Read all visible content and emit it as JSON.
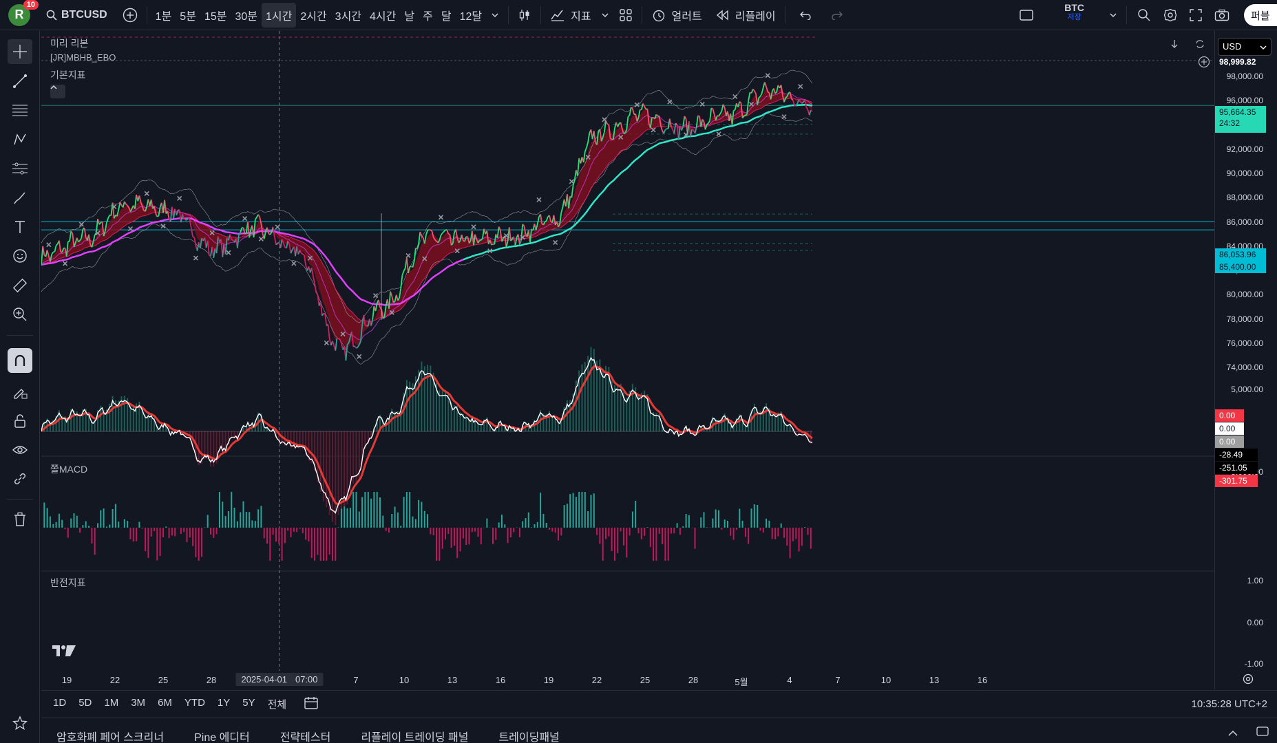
{
  "topbar": {
    "avatar_letter": "R",
    "notif_count": "10",
    "symbol": "BTCUSD",
    "timeframes": [
      "1분",
      "5분",
      "15분",
      "30분",
      "1시간",
      "2시간",
      "3시간",
      "4시간",
      "날",
      "주",
      "달",
      "12달"
    ],
    "active_timeframe": "1시간",
    "indicators_label": "지표",
    "alert_label": "얼러트",
    "replay_label": "리플레이",
    "layout_name": "BTC",
    "layout_sub": "저장",
    "publish_label": "퍼블"
  },
  "panes": {
    "main_labels": [
      "미리 리본",
      "[JR]MBHB_EBO",
      "기본지표"
    ],
    "macd_label": "쫄MACD",
    "reversal_label": "반전지표"
  },
  "price_scale": {
    "currency": "USD",
    "main_ticks": [
      "98,000.00",
      "96,000.00",
      "94,000.00",
      "92,000.00",
      "90,000.00",
      "88,000.00",
      "86,000.00",
      "84,000.00",
      "82,000.00",
      "80,000.00",
      "78,000.00",
      "76,000.00",
      "74,000.00"
    ],
    "top_price": "98,999.82",
    "last_price": "95,664.35",
    "countdown": "24:32",
    "level_1": "86,053.96",
    "level_2": "85,400.00",
    "macd_ticks": [
      "5,000.00",
      "-5,000.00"
    ],
    "macd_values": [
      "0.00",
      "0.00",
      "0.00",
      "-28.49",
      "-251.05",
      "-301.75"
    ],
    "reversal_ticks": [
      "1.00",
      "0.00",
      "-1.00"
    ]
  },
  "time_axis": {
    "labels": [
      "19",
      "22",
      "25",
      "28",
      "4",
      "7",
      "10",
      "13",
      "16",
      "19",
      "22",
      "25",
      "28",
      "5월",
      "4",
      "7",
      "10",
      "13",
      "16"
    ],
    "crosshair_date": "2025-04-01",
    "crosshair_time": "07:00"
  },
  "range_bar": {
    "ranges": [
      "1D",
      "5D",
      "1M",
      "3M",
      "6M",
      "YTD",
      "1Y",
      "5Y",
      "전체"
    ],
    "clock": "10:35:28 UTC+2"
  },
  "bottom_tabs": [
    "암호화폐 페어 스크리너",
    "Pine 에디터",
    "전략테스터",
    "리플레이 트레이딩 패널",
    "트레이딩패널"
  ],
  "colors": {
    "background": "#131722",
    "up": "#26a69a",
    "down": "#c2185b",
    "last_price_tag": "#26a69a",
    "level_tag": "#00bcd4",
    "ribbon_fill": "#8b0f1f",
    "baseline": "#2ee6c8"
  },
  "chart_data": {
    "type": "line",
    "title": "",
    "ylim": [
      73000,
      99500
    ],
    "x": [
      "19",
      "22",
      "25",
      "28",
      "4",
      "7",
      "10",
      "13",
      "16",
      "19",
      "22",
      "25",
      "28",
      "5월",
      "4"
    ],
    "series": [
      {
        "values": [
          83200,
          84600,
          87500,
          87000,
          83800,
          85600,
          83500,
          75500,
          79000,
          84800,
          84500,
          84800,
          86300,
          93300,
          94900,
          93800,
          94800,
          96900,
          95700
        ]
      }
    ],
    "levels": [
      86053.96,
      85400
    ],
    "last_price": 95664.35
  }
}
